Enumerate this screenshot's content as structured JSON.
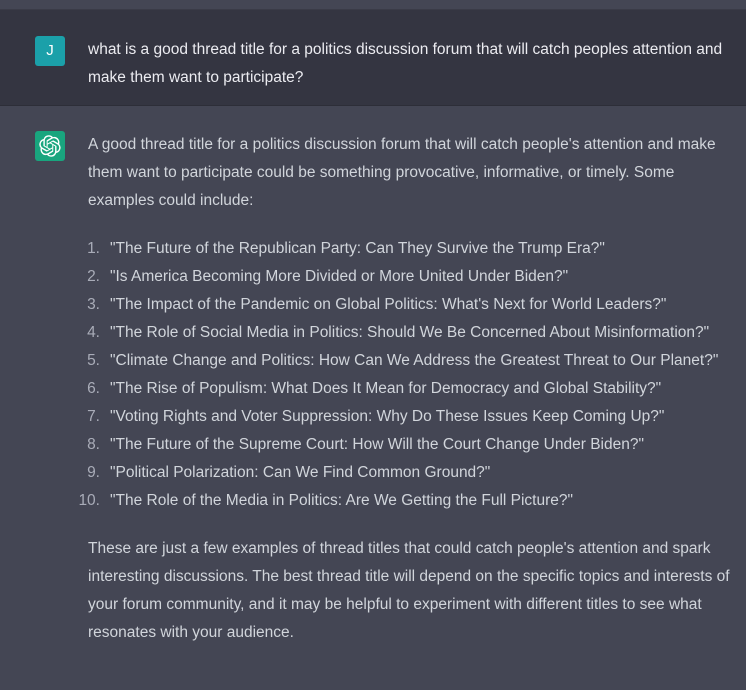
{
  "user_message": {
    "avatar_initial": "J",
    "text": "what is a good thread title for a politics discussion forum that will catch peoples attention and make them want to participate?"
  },
  "assistant_message": {
    "avatar_icon": "openai-logo-icon",
    "intro": "A good thread title for a politics discussion forum that will catch people's attention and make them want to participate could be something provocative, informative, or timely. Some examples could include:",
    "examples": [
      {
        "num": "1.",
        "text": "\"The Future of the Republican Party: Can They Survive the Trump Era?\""
      },
      {
        "num": "2.",
        "text": "\"Is America Becoming More Divided or More United Under Biden?\""
      },
      {
        "num": "3.",
        "text": "\"The Impact of the Pandemic on Global Politics: What's Next for World Leaders?\""
      },
      {
        "num": "4.",
        "text": "\"The Role of Social Media in Politics: Should We Be Concerned About Misinformation?\""
      },
      {
        "num": "5.",
        "text": "\"Climate Change and Politics: How Can We Address the Greatest Threat to Our Planet?\""
      },
      {
        "num": "6.",
        "text": "\"The Rise of Populism: What Does It Mean for Democracy and Global Stability?\""
      },
      {
        "num": "7.",
        "text": "\"Voting Rights and Voter Suppression: Why Do These Issues Keep Coming Up?\""
      },
      {
        "num": "8.",
        "text": "\"The Future of the Supreme Court: How Will the Court Change Under Biden?\""
      },
      {
        "num": "9.",
        "text": "\"Political Polarization: Can We Find Common Ground?\""
      },
      {
        "num": "10.",
        "text": "\"The Role of the Media in Politics: Are We Getting the Full Picture?\""
      }
    ],
    "closing": "These are just a few examples of thread titles that could catch people's attention and spark interesting discussions. The best thread title will depend on the specific topics and interests of your forum community, and it may be helpful to experiment with different titles to see what resonates with your audience."
  },
  "colors": {
    "user_bg": "#343541",
    "assistant_bg": "#444654",
    "user_avatar": "#1ba0a9",
    "bot_avatar": "#19a57e",
    "text": "#d1d5db"
  }
}
